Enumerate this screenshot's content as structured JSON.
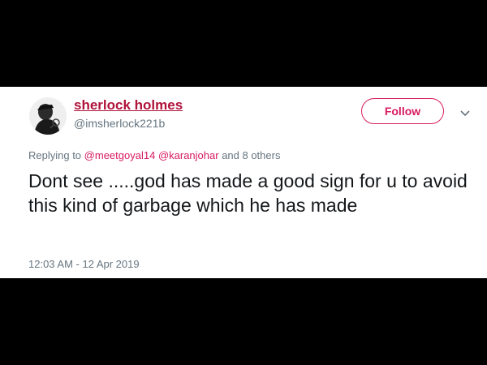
{
  "colors": {
    "background": "#000000",
    "card": "#ffffff",
    "accent": "#d81b5f",
    "name": "#b0123a",
    "muted": "#66757f",
    "text": "#14171a"
  },
  "user": {
    "avatar_icon": "avatar-image",
    "name": "sherlock holmes",
    "handle": "@imsherlock221b"
  },
  "actions": {
    "follow_label": "Follow",
    "more_icon": "chevron-down-icon"
  },
  "reply": {
    "prefix": "Replying to",
    "mention_1": "@meetgoyal14",
    "mention_2": "@karanjohar",
    "suffix": "and 8 others"
  },
  "tweet": {
    "text": "Dont see .....god has made a good sign for u to avoid this kind of garbage which he has made",
    "timestamp": "12:03 AM - 12 Apr 2019"
  }
}
